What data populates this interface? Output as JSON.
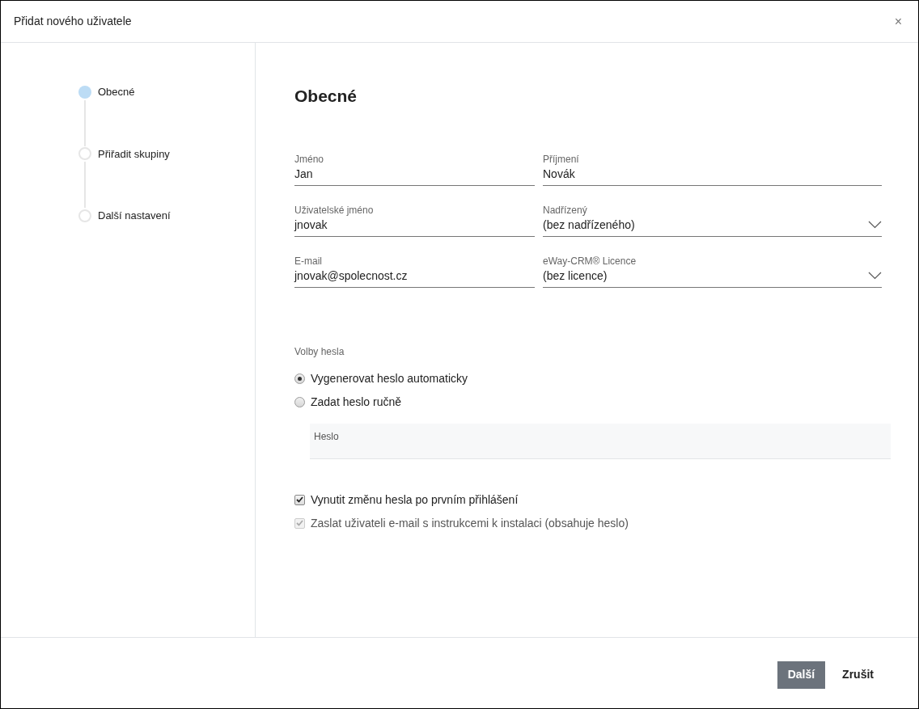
{
  "dialog": {
    "title": "Přidat nového uživatele",
    "close": "×"
  },
  "steps": [
    {
      "label": "Obecné",
      "selected": true
    },
    {
      "label": "Přiřadit skupiny",
      "selected": false
    },
    {
      "label": "Další nastavení",
      "selected": false
    }
  ],
  "heading": "Obecné",
  "fields": [
    {
      "kind": "text",
      "label": "Jméno",
      "value": "Jan"
    },
    {
      "kind": "text",
      "label": "Příjmení",
      "value": "Novák"
    },
    {
      "kind": "text",
      "label": "Uživatelské jméno",
      "value": "jnovak"
    },
    {
      "kind": "select",
      "label": "Nadřízený",
      "value": "(bez nadřízeného)"
    },
    {
      "kind": "text",
      "label": "E-mail",
      "value": "jnovak@spolecnost.cz"
    },
    {
      "kind": "select",
      "label": "eWay-CRM® Licence",
      "value": "(bez licence)"
    }
  ],
  "password_options": {
    "label": "Volby hesla",
    "options": [
      {
        "label": "Vygenerovat heslo automaticky",
        "selected": true
      },
      {
        "label": "Zadat heslo ručně",
        "selected": false
      }
    ],
    "password_field": {
      "label": "Heslo"
    }
  },
  "checkboxes": [
    {
      "label": "Vynutit změnu hesla po prvním přihlášení",
      "checked": true,
      "disabled": false
    },
    {
      "label": "Zaslat uživateli e-mail s instrukcemi k instalaci (obsahuje heslo)",
      "checked": true,
      "disabled": true
    }
  ],
  "buttons": [
    {
      "label": "Další",
      "kind": "primary"
    },
    {
      "label": "Zrušit",
      "kind": "secondary"
    }
  ]
}
